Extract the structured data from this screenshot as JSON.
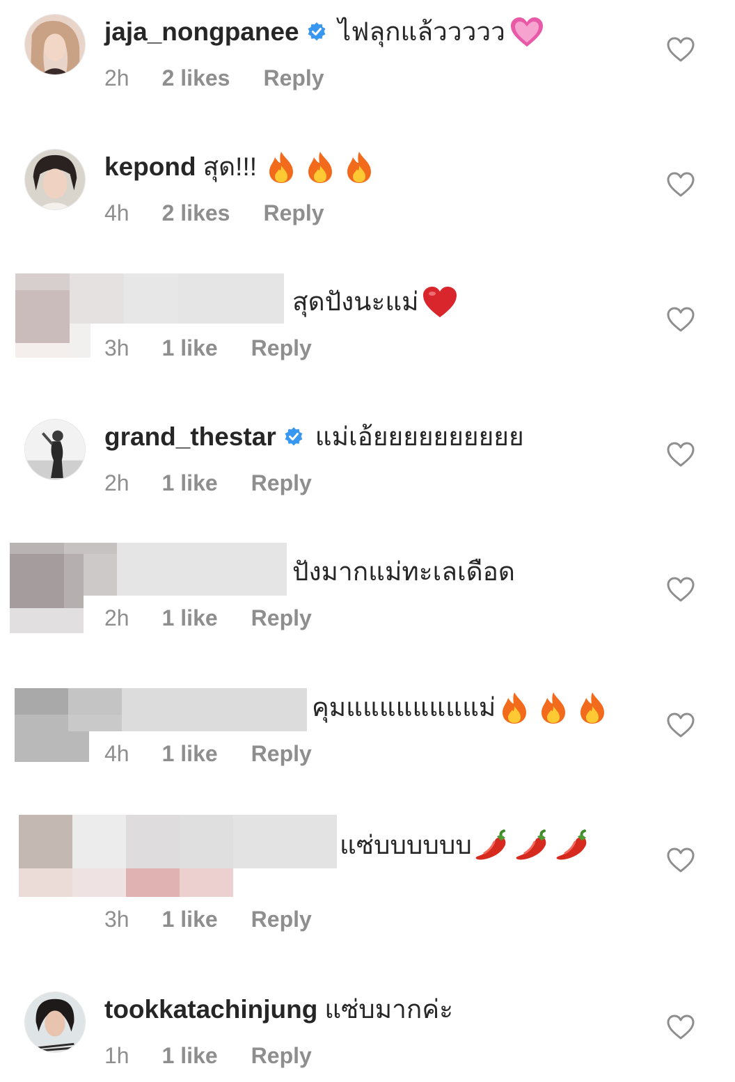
{
  "comments": [
    {
      "username": "jaja_nongpanee",
      "verified": true,
      "text": "ไฟลุกแล้ววววว",
      "emoji": "pink-heart",
      "time": "2h",
      "likes": "2 likes",
      "reply": "Reply"
    },
    {
      "username": "kepond",
      "verified": false,
      "text": "สุด!!!",
      "emoji": "fire",
      "time": "4h",
      "likes": "2 likes",
      "reply": "Reply"
    },
    {
      "username": "",
      "verified": false,
      "text": "สุดปังนะแม่",
      "emoji": "red-heart",
      "time": "3h",
      "likes": "1 like",
      "reply": "Reply"
    },
    {
      "username": "grand_thestar",
      "verified": true,
      "text": "แม่เอ้ยยยยยยยยยย",
      "emoji": "",
      "time": "2h",
      "likes": "1 like",
      "reply": "Reply"
    },
    {
      "username": "",
      "verified": false,
      "text": "ปังมากแม่ทะเลเดือด",
      "emoji": "",
      "time": "2h",
      "likes": "1 like",
      "reply": "Reply"
    },
    {
      "username": "",
      "verified": false,
      "text": "คุมแแแแแแแแม่",
      "emoji": "fire",
      "time": "4h",
      "likes": "1 like",
      "reply": "Reply"
    },
    {
      "username": "",
      "verified": false,
      "text": "แซ่บบบบบบ",
      "emoji": "chili",
      "time": "3h",
      "likes": "1 like",
      "reply": "Reply"
    },
    {
      "username": "tookkatachinjung",
      "verified": false,
      "text": "แซ่บมากค่ะ",
      "emoji": "",
      "time": "1h",
      "likes": "1 like",
      "reply": "Reply"
    }
  ],
  "icons": {
    "verified": "verified-badge-icon",
    "like": "heart-outline-icon"
  },
  "colors": {
    "verified": "#3897f0",
    "meta_text": "#8e8e8e",
    "body_text": "#262626"
  }
}
